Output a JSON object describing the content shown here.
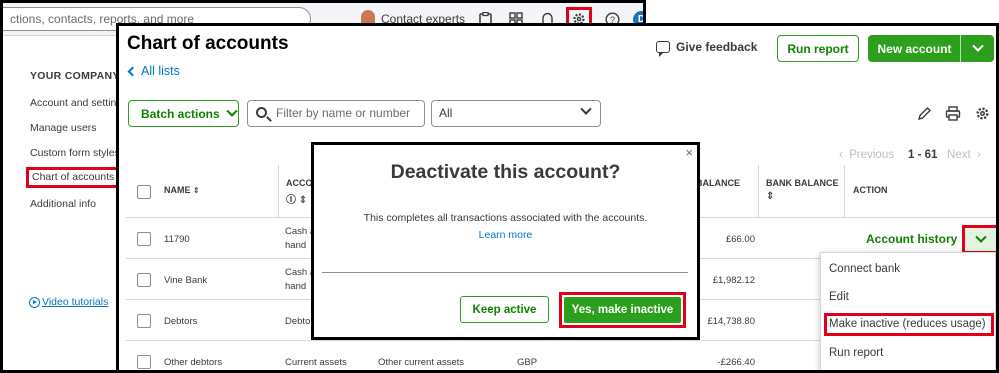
{
  "top_bar": {
    "search_text": "ctions, contacts, reports, and more",
    "contact_experts": "Contact experts",
    "user_initial": "D"
  },
  "gear_menu": {
    "heading": "YOUR COMPANY",
    "items": [
      "Account and settings",
      "Manage users",
      "Custom form styles",
      "Chart of accounts",
      "Additional info"
    ],
    "video_tutorials": "Video tutorials"
  },
  "page": {
    "title": "Chart of accounts",
    "all_lists": "All lists",
    "give_feedback": "Give feedback",
    "run_report": "Run report",
    "new_account": "New account",
    "batch_actions": "Batch actions",
    "filter_placeholder": "Filter by name or number",
    "type_filter": "All"
  },
  "pager": {
    "previous": "Previous",
    "range": "1 - 61",
    "next": "Next"
  },
  "table": {
    "headers": {
      "name": "NAME",
      "account_type": "ACCO",
      "balance": "BALANCE",
      "bank_balance": "BANK BALANCE",
      "action": "ACTION"
    },
    "rows": [
      {
        "name": "11790",
        "type_line1": "Cash a",
        "type_line2": "hand",
        "detail": "",
        "currency": "",
        "balance": "£66.00"
      },
      {
        "name": "Vine Bank",
        "type_line1": "Cash a",
        "type_line2": "hand",
        "detail": "",
        "currency": "",
        "balance": "£1,982.12"
      },
      {
        "name": "Debtors",
        "type_line1": "Debto",
        "type_line2": "",
        "detail": "",
        "currency": "",
        "balance": "£14,738.80"
      },
      {
        "name": "Other debtors",
        "type_line1": "Current assets",
        "type_line2": "",
        "detail": "Other current assets",
        "currency": "GBP",
        "balance": "-£266.40"
      }
    ],
    "account_history": "Account history"
  },
  "action_menu": {
    "items": [
      "Connect bank",
      "Edit",
      "Make inactive (reduces usage)",
      "Run report"
    ]
  },
  "modal": {
    "close": "×",
    "title": "Deactivate this account?",
    "body": "This completes all transactions associated with the accounts.",
    "learn_more": "Learn more",
    "keep_active": "Keep active",
    "make_inactive": "Yes, make inactive"
  },
  "colors": {
    "brand_green": "#2ca01c",
    "highlight_red": "#e0001b",
    "link_blue": "#0077c5"
  }
}
